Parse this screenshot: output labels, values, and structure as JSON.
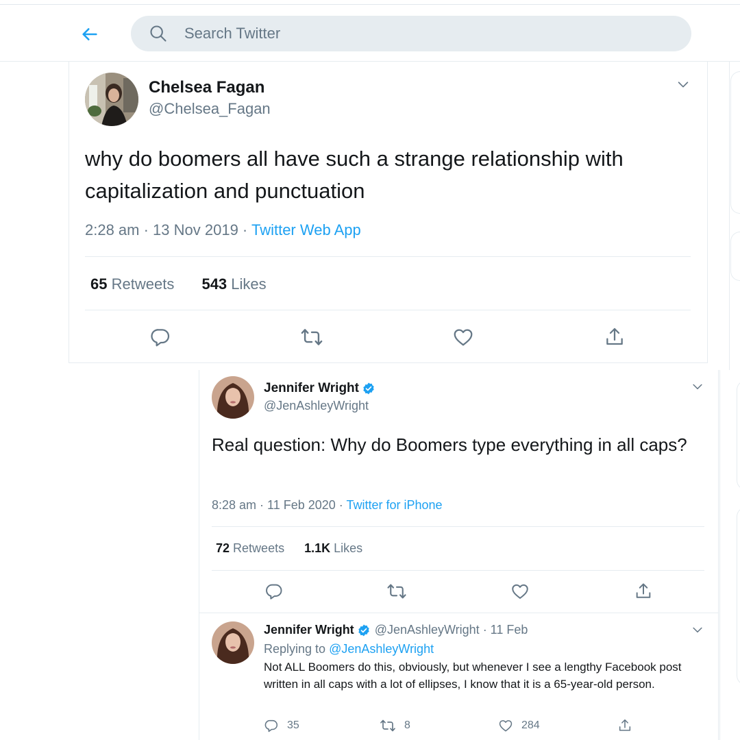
{
  "search": {
    "placeholder": "Search Twitter"
  },
  "colors": {
    "accent": "#1da1f2",
    "secondary_text": "#657786",
    "primary_text": "#14171a",
    "divider": "#e6ecf0"
  },
  "tweet1": {
    "name": "Chelsea Fagan",
    "handle": "@Chelsea_Fagan",
    "text": "why do boomers all have such a strange relationship with capitalization and punctuation",
    "time_date": "2:28 am · 13 Nov 2019 ·",
    "source": "Twitter Web App",
    "retweets_count": "65",
    "retweets_label": "Retweets",
    "likes_count": "543",
    "likes_label": "Likes"
  },
  "tweet2": {
    "name": "Jennifer Wright",
    "verified": true,
    "handle": "@JenAshleyWright",
    "text": "Real question: Why do Boomers type everything in all caps?",
    "time_date": "8:28 am · 11 Feb 2020 ·",
    "source": "Twitter for iPhone",
    "retweets_count": "72",
    "retweets_label": "Retweets",
    "likes_count": "1.1K",
    "likes_label": "Likes"
  },
  "reply": {
    "name": "Jennifer Wright",
    "verified": true,
    "handle_date": "@JenAshleyWright · 11 Feb",
    "replying_prefix": "Replying to",
    "replying_to": "@JenAshleyWright",
    "text": "Not ALL Boomers do this, obviously, but whenever I see a lengthy Facebook post written in all caps with a lot of ellipses, I know that it is a 65-year-old person.",
    "reply_count": "35",
    "retweet_count": "8",
    "like_count": "284"
  },
  "icons": {
    "back": "arrow-left-icon",
    "search": "search-icon",
    "caret": "chevron-down-icon",
    "reply": "reply-icon",
    "retweet": "retweet-icon",
    "like": "heart-icon",
    "share": "share-icon",
    "verified": "verified-badge-icon"
  }
}
